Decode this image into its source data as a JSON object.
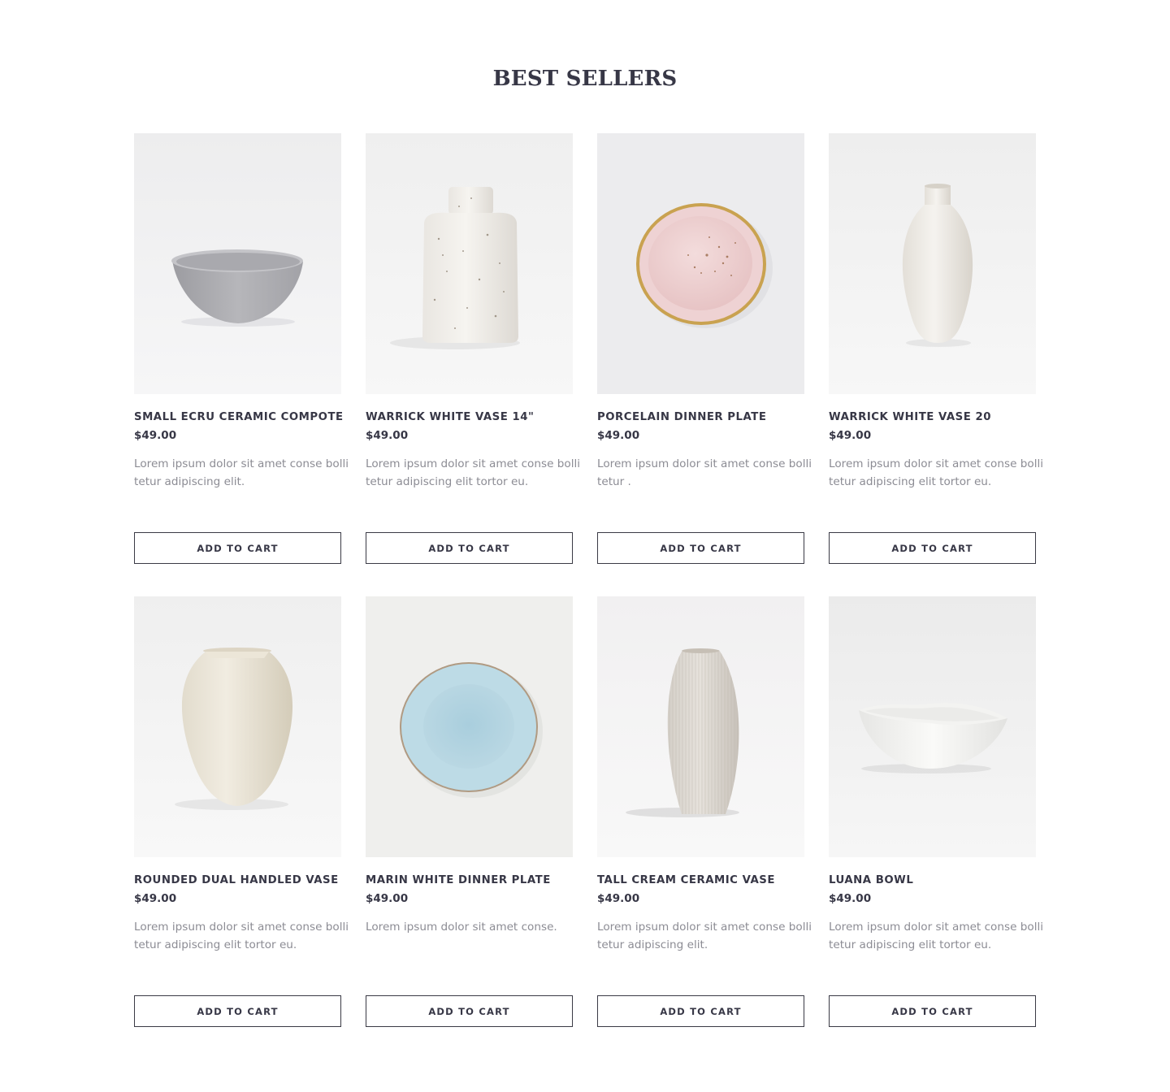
{
  "section": {
    "title": "BEST SELLERS"
  },
  "products": [
    {
      "name": "SMALL ECRU CERAMIC COMPOTE",
      "price": "$49.00",
      "description": "Lorem ipsum dolor sit amet conse bolli tetur adipiscing elit.",
      "button_label": "ADD TO CART",
      "image": "grey-ceramic-bowl"
    },
    {
      "name": "WARRICK WHITE VASE 14\"",
      "price": "$49.00",
      "description": "Lorem ipsum dolor sit amet conse bolli tetur adipiscing elit tortor eu.",
      "button_label": "ADD TO CART",
      "image": "speckled-white-vase"
    },
    {
      "name": "PORCELAIN DINNER PLATE",
      "price": "$49.00",
      "description": "Lorem ipsum dolor sit amet conse bolli tetur .",
      "button_label": "ADD TO CART",
      "image": "pink-gold-rim-plate"
    },
    {
      "name": "WARRICK WHITE VASE 20",
      "price": "$49.00",
      "description": "Lorem ipsum dolor sit amet conse bolli tetur adipiscing elit tortor eu.",
      "button_label": "ADD TO CART",
      "image": "tall-white-vase"
    },
    {
      "name": "ROUNDED DUAL HANDLED VASE",
      "price": "$49.00",
      "description": "Lorem ipsum dolor sit amet conse bolli tetur adipiscing elit tortor eu.",
      "button_label": "ADD TO CART",
      "image": "cream-rounded-vase"
    },
    {
      "name": "MARIN WHITE DINNER PLATE",
      "price": "$49.00",
      "description": "Lorem ipsum dolor sit amet conse.",
      "button_label": "ADD TO CART",
      "image": "blue-dinner-plate"
    },
    {
      "name": "TALL CREAM CERAMIC VASE",
      "price": "$49.00",
      "description": "Lorem ipsum dolor sit amet conse bolli tetur adipiscing elit.",
      "button_label": "ADD TO CART",
      "image": "ribbed-cream-vase"
    },
    {
      "name": "LUANA BOWL",
      "price": "$49.00",
      "description": "Lorem ipsum dolor sit amet conse bolli tetur adipiscing elit tortor eu.",
      "button_label": "ADD TO CART",
      "image": "white-shallow-bowl"
    }
  ],
  "colors": {
    "heading": "#373746",
    "body_text": "#8c8c94",
    "button_border": "#3a3a45",
    "background": "#ffffff"
  }
}
